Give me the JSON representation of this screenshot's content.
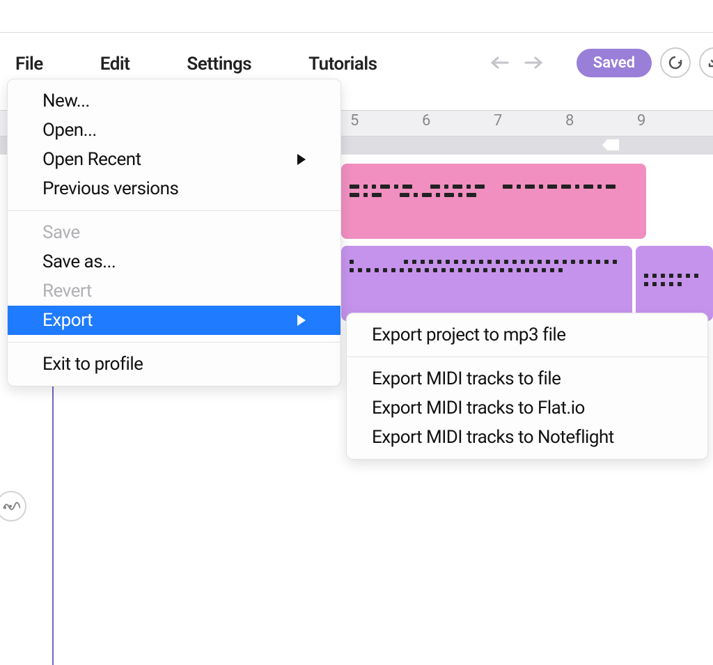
{
  "menubar": {
    "file": "File",
    "edit": "Edit",
    "settings": "Settings",
    "tutorials": "Tutorials"
  },
  "toolbar": {
    "saved_label": "Saved"
  },
  "file_menu": {
    "new": "New...",
    "open": "Open...",
    "open_recent": "Open Recent",
    "previous_versions": "Previous versions",
    "save": "Save",
    "save_as": "Save as...",
    "revert": "Revert",
    "export": "Export",
    "exit": "Exit to profile"
  },
  "export_submenu": {
    "mp3": "Export project to mp3 file",
    "midi_file": "Export MIDI tracks to file",
    "midi_flat": "Export MIDI tracks to Flat.io",
    "midi_noteflight": "Export MIDI tracks to Noteflight"
  },
  "ruler": {
    "labels": [
      "5",
      "6",
      "7",
      "8",
      "9"
    ]
  },
  "colors": {
    "accent": "#1f7bff",
    "saved_pill": "#9a7fd9",
    "clip_pink": "#f08fc0",
    "clip_purple": "#c593ec"
  }
}
